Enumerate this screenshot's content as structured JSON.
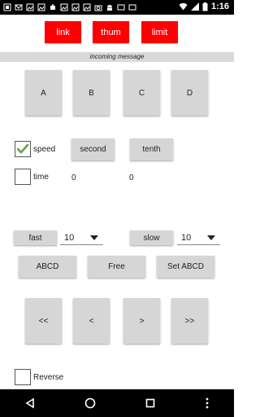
{
  "status_bar": {
    "time": "1:16",
    "left_icons": [
      "notification-icon",
      "mail-icon",
      "image-icon",
      "image-icon",
      "robot-icon",
      "image-icon",
      "image-icon",
      "image-icon",
      "camera-icon",
      "android-icon",
      "cast-icon",
      "cast-icon"
    ],
    "right_icons": [
      "wifi-icon",
      "cellular-icon",
      "battery-icon"
    ]
  },
  "top_buttons": {
    "link": "link",
    "thum": "thum",
    "limit": "limit"
  },
  "banner": {
    "text": "incoming message"
  },
  "letter_buttons": [
    "A",
    "B",
    "C",
    "D"
  ],
  "speed": {
    "label": "speed",
    "checked": true
  },
  "second_button": "second",
  "tenth_button": "tenth",
  "time": {
    "label": "time",
    "checked": false,
    "value1": "0",
    "value2": "0"
  },
  "fast_button": "fast",
  "fast_select": {
    "value": "10"
  },
  "slow_button": "slow",
  "slow_select": {
    "value": "10"
  },
  "abcd_button": "ABCD",
  "free_button": "Free",
  "set_abcd_button": "Set ABCD",
  "nav_buttons": [
    "<<",
    "<",
    ">",
    ">>"
  ],
  "reverse": {
    "label": "Reverse",
    "checked": false
  },
  "colors": {
    "red": "#ff0000",
    "gray_button": "#d6d6d6",
    "check_green": "#5aa832"
  }
}
